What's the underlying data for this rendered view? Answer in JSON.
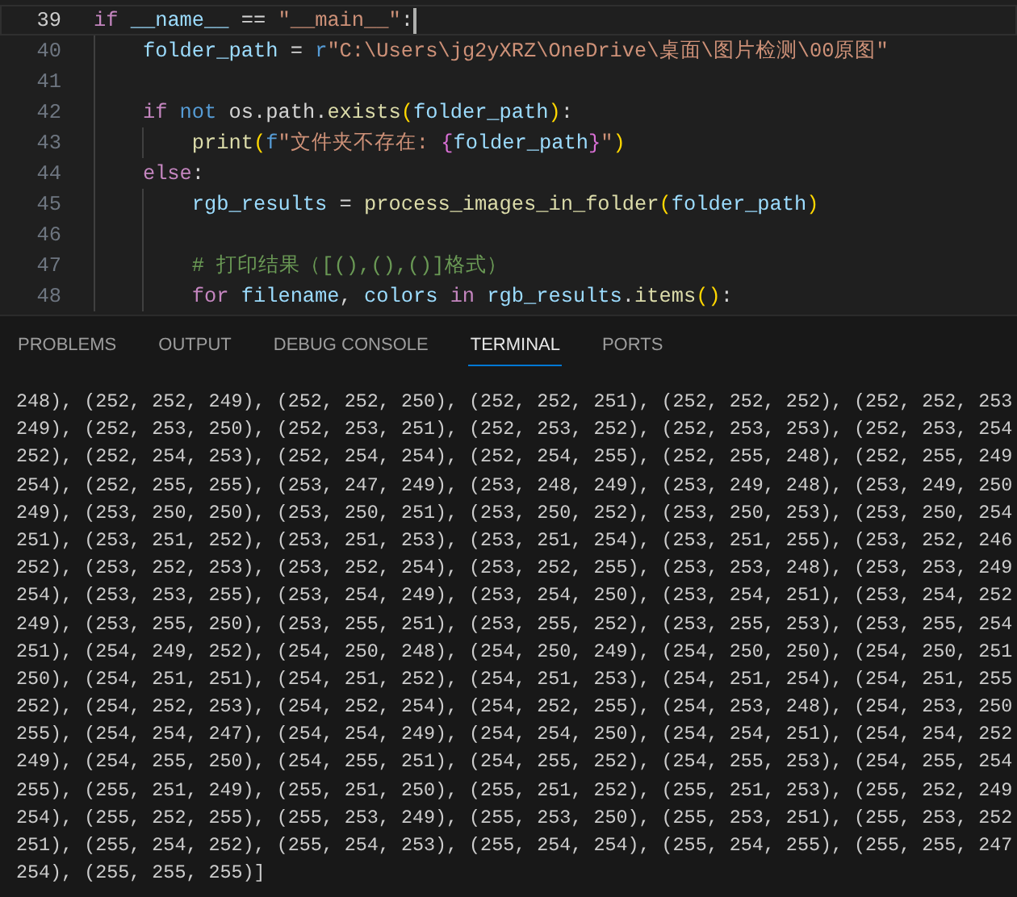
{
  "editor": {
    "lines": [
      {
        "number": "39",
        "current": true,
        "tokens": [
          {
            "kind": "ctl",
            "text": "if"
          },
          {
            "kind": "var",
            "text": " __name__"
          },
          {
            "kind": "plain",
            "text": " == "
          },
          {
            "kind": "str",
            "text": "\"__main__\""
          },
          {
            "kind": "plain",
            "text": ":"
          }
        ],
        "children": [
          {
            "number": "40",
            "current": false,
            "tokens": [
              {
                "kind": "var",
                "text": "folder_path"
              },
              {
                "kind": "plain",
                "text": " = "
              },
              {
                "kind": "kw",
                "text": "r"
              },
              {
                "kind": "str",
                "text": "\"C:\\Users\\jg2yXRZ\\OneDrive\\桌面\\图片检测\\00原图\""
              }
            ]
          },
          {
            "number": "41",
            "current": false
          },
          {
            "number": "42",
            "current": false,
            "tokens": [
              {
                "kind": "ctl",
                "text": "if"
              },
              {
                "kind": "kw",
                "text": " not"
              },
              {
                "kind": "plain",
                "text": " os.path."
              },
              {
                "kind": "fn",
                "text": "exists"
              },
              {
                "kind": "paren",
                "text": "("
              },
              {
                "kind": "var",
                "text": "folder_path"
              },
              {
                "kind": "paren",
                "text": ")"
              },
              {
                "kind": "plain",
                "text": ":"
              }
            ],
            "children": [
              {
                "number": "43",
                "current": false,
                "tokens": [
                  {
                    "kind": "fn",
                    "text": "print"
                  },
                  {
                    "kind": "paren",
                    "text": "("
                  },
                  {
                    "kind": "kw",
                    "text": "f"
                  },
                  {
                    "kind": "str",
                    "text": "\"文件夹不存在: "
                  },
                  {
                    "kind": "brace",
                    "text": "{"
                  },
                  {
                    "kind": "var",
                    "text": "folder_path"
                  },
                  {
                    "kind": "brace",
                    "text": "}"
                  },
                  {
                    "kind": "str",
                    "text": "\""
                  },
                  {
                    "kind": "paren",
                    "text": ")"
                  }
                ]
              }
            ]
          },
          {
            "number": "44",
            "current": false,
            "tokens": [
              {
                "kind": "ctl",
                "text": "else"
              },
              {
                "kind": "plain",
                "text": ":"
              }
            ],
            "children": [
              {
                "number": "45",
                "current": false,
                "tokens": [
                  {
                    "kind": "var",
                    "text": "rgb_results"
                  },
                  {
                    "kind": "plain",
                    "text": " = "
                  },
                  {
                    "kind": "fn",
                    "text": "process_images_in_folder"
                  },
                  {
                    "kind": "paren",
                    "text": "("
                  },
                  {
                    "kind": "var",
                    "text": "folder_path"
                  },
                  {
                    "kind": "paren",
                    "text": ")"
                  }
                ]
              },
              {
                "number": "46",
                "current": false
              },
              {
                "number": "47",
                "current": false,
                "tokens": [
                  {
                    "kind": "cmt",
                    "text": "# 打印结果（[(),(),()]格式）"
                  }
                ]
              },
              {
                "number": "48",
                "current": false,
                "tokens": [
                  {
                    "kind": "ctl",
                    "text": "for"
                  },
                  {
                    "kind": "var",
                    "text": " filename"
                  },
                  {
                    "kind": "plain",
                    "text": ", "
                  },
                  {
                    "kind": "var",
                    "text": "colors"
                  },
                  {
                    "kind": "ctl",
                    "text": " in"
                  },
                  {
                    "kind": "var",
                    "text": " rgb_results"
                  },
                  {
                    "kind": "plain",
                    "text": "."
                  },
                  {
                    "kind": "fn",
                    "text": "items"
                  },
                  {
                    "kind": "paren",
                    "text": "()"
                  },
                  {
                    "kind": "plain",
                    "text": ":"
                  }
                ]
              }
            ]
          }
        ]
      }
    ]
  },
  "panel": {
    "tabs": [
      {
        "label": "PROBLEMS",
        "selected": false
      },
      {
        "label": "OUTPUT",
        "selected": false
      },
      {
        "label": "DEBUG CONSOLE",
        "selected": false
      },
      {
        "label": "TERMINAL",
        "selected": true
      },
      {
        "label": "PORTS",
        "selected": false
      }
    ],
    "terminal_lines": [
      "248), (252, 252, 249), (252, 252, 250), (252, 252, 251), (252, 252, 252), (252, 252, 253",
      "249), (252, 253, 250), (252, 253, 251), (252, 253, 252), (252, 253, 253), (252, 253, 254",
      "252), (252, 254, 253), (252, 254, 254), (252, 254, 255), (252, 255, 248), (252, 255, 249",
      "254), (252, 255, 255), (253, 247, 249), (253, 248, 249), (253, 249, 248), (253, 249, 250",
      "249), (253, 250, 250), (253, 250, 251), (253, 250, 252), (253, 250, 253), (253, 250, 254",
      "251), (253, 251, 252), (253, 251, 253), (253, 251, 254), (253, 251, 255), (253, 252, 246",
      "252), (253, 252, 253), (253, 252, 254), (253, 252, 255), (253, 253, 248), (253, 253, 249",
      "254), (253, 253, 255), (253, 254, 249), (253, 254, 250), (253, 254, 251), (253, 254, 252",
      "249), (253, 255, 250), (253, 255, 251), (253, 255, 252), (253, 255, 253), (253, 255, 254",
      "251), (254, 249, 252), (254, 250, 248), (254, 250, 249), (254, 250, 250), (254, 250, 251",
      "250), (254, 251, 251), (254, 251, 252), (254, 251, 253), (254, 251, 254), (254, 251, 255",
      "252), (254, 252, 253), (254, 252, 254), (254, 252, 255), (254, 253, 248), (254, 253, 250",
      "255), (254, 254, 247), (254, 254, 249), (254, 254, 250), (254, 254, 251), (254, 254, 252",
      "249), (254, 255, 250), (254, 255, 251), (254, 255, 252), (254, 255, 253), (254, 255, 254",
      "255), (255, 251, 249), (255, 251, 250), (255, 251, 252), (255, 251, 253), (255, 252, 249",
      "254), (255, 252, 255), (255, 253, 249), (255, 253, 250), (255, 253, 251), (255, 253, 252",
      "251), (255, 254, 252), (255, 254, 253), (255, 254, 254), (255, 254, 255), (255, 255, 247",
      "254), (255, 255, 255)]"
    ]
  }
}
